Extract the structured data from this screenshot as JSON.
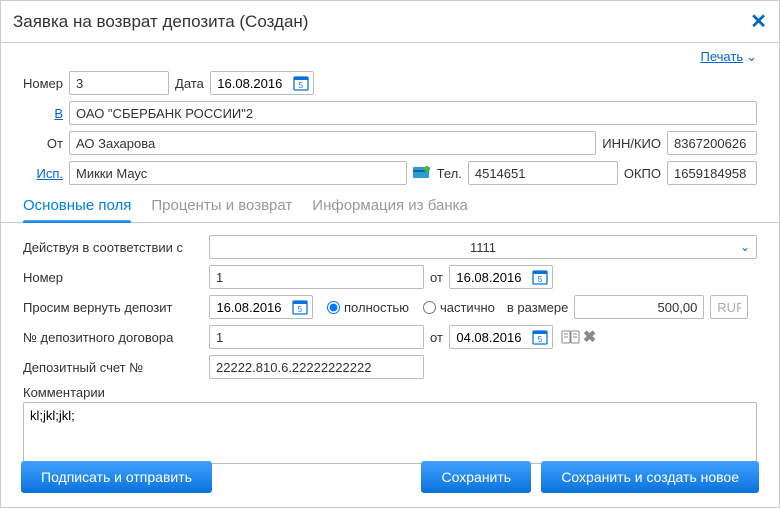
{
  "title": "Заявка на возврат депозита (Создан)",
  "print_label": "Печать",
  "header": {
    "number_label": "Номер",
    "number_value": "3",
    "date_label": "Дата",
    "date_value": "16.08.2016",
    "to_label": "В",
    "to_value": "ОАО \"СБЕРБАНК РОССИИ\"2",
    "from_label": "От",
    "from_value": "АО Захарова",
    "innkio_label": "ИНН/КИО",
    "innkio_value": "8367200626",
    "isp_label": "Исп.",
    "isp_value": "Микки Маус",
    "tel_label": "Тел.",
    "tel_value": "4514651",
    "okpo_label": "ОКПО",
    "okpo_value": "1659184958"
  },
  "tabs": {
    "main": "Основные поля",
    "percent": "Проценты и возврат",
    "bankinfo": "Информация из банка"
  },
  "main": {
    "acting_label": "Действуя в соответствии с",
    "acting_value": "1111",
    "number_label": "Номер",
    "contract_number": "1",
    "ot_label": "от",
    "contract_date": "16.08.2016",
    "return_label": "Просим вернуть депозит",
    "return_date": "16.08.2016",
    "radio_full": "полностью",
    "radio_partial": "частично",
    "amount_label": "в размере",
    "amount_value": "500,00",
    "currency": "RUR",
    "dep_contract_label": "№ депозитного договора",
    "dep_contract_number": "1",
    "dep_contract_date": "04.08.2016",
    "dep_account_label": "Депозитный счет №",
    "dep_account_value": "22222.810.6.22222222222",
    "comments_label": "Комментарии",
    "comments_value": "kl;jkl;jkl;"
  },
  "actions": {
    "sign_send": "Подписать и отправить",
    "save": "Сохранить",
    "save_new": "Сохранить и создать новое"
  }
}
